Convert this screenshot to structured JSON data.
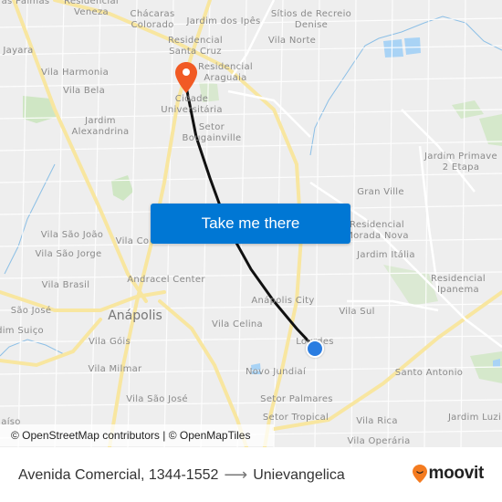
{
  "map": {
    "labels": [
      {
        "text": "as Palmas"
      },
      {
        "text": "Residencial\nVeneza"
      },
      {
        "text": "Chácaras\nColorado"
      },
      {
        "text": "Jardim dos Ipês"
      },
      {
        "text": "Sítios de Recreio\nDenise"
      },
      {
        "text": "Residencial\nSanta Cruz"
      },
      {
        "text": "Vila Norte"
      },
      {
        "text": "Jayara"
      },
      {
        "text": "Residencial\nAraguaia"
      },
      {
        "text": "Vila Harmonia"
      },
      {
        "text": "Vila Bela"
      },
      {
        "text": "Cidade\nUniversitária"
      },
      {
        "text": "Jardim\nAlexandrina"
      },
      {
        "text": "Setor\nBougainville"
      },
      {
        "text": "Jardim Primave\n2 Etapa"
      },
      {
        "text": "Gran Ville"
      },
      {
        "text": "Residencial\nMorada Nova"
      },
      {
        "text": "Vila São João"
      },
      {
        "text": "Vila Co"
      },
      {
        "text": "Vila São Jorge"
      },
      {
        "text": "Jardim Itália"
      },
      {
        "text": "Andracel Center"
      },
      {
        "text": "Residencial\nIpanema"
      },
      {
        "text": "Vila Brasil"
      },
      {
        "text": "Anápolis City"
      },
      {
        "text": "São José"
      },
      {
        "text": "Vila Sul"
      },
      {
        "text": "dim Suiço"
      },
      {
        "text": "Vila Celina"
      },
      {
        "text": "Vila Góis"
      },
      {
        "text": "Lourdes"
      },
      {
        "text": "Vila Milmar"
      },
      {
        "text": "Novo Jundiaí"
      },
      {
        "text": "Santo Antonio"
      },
      {
        "text": "Vila São José"
      },
      {
        "text": "Setor Palmares"
      },
      {
        "text": "Setor Tropical"
      },
      {
        "text": "Vila Rica"
      },
      {
        "text": "Jardim Luzi"
      },
      {
        "text": "Vila Operária"
      },
      {
        "text": "aíso"
      }
    ],
    "city_label": "Anápolis",
    "cta_label": "Take me there",
    "attribution": "© OpenStreetMap contributors | © OpenMapTiles",
    "destination_marker": "destination-pin-icon",
    "origin_marker": "origin-dot-icon"
  },
  "footer": {
    "origin": "Avenida Comercial, 1344-1552",
    "arrow": "⟶",
    "destination": "Unievangelica",
    "brand": "moovit"
  },
  "colors": {
    "cta": "#0077d4",
    "pin": "#f15a24",
    "dot": "#2a7de1",
    "route": "#111111",
    "brand": "#f47b20"
  }
}
